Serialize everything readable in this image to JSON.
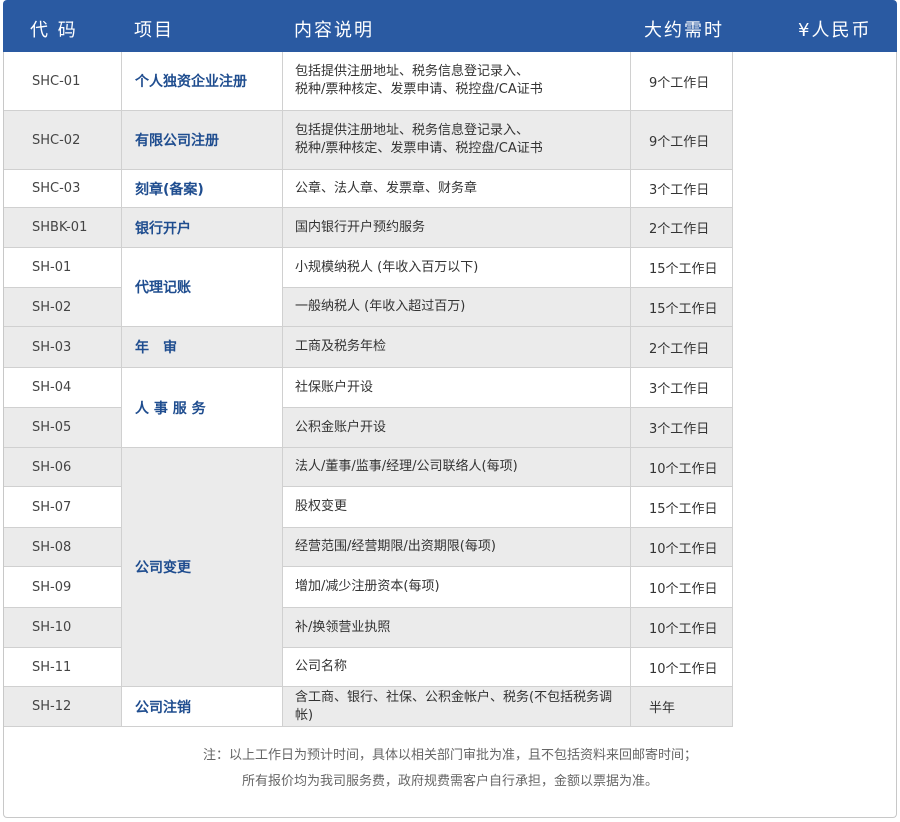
{
  "header": {
    "code": "代 码",
    "item": "项目",
    "desc": "内容说明",
    "time": "大约需时",
    "price": "¥人民币"
  },
  "rows": [
    {
      "code": "SHC-01",
      "desc": "包括提供注册地址、税务信息登记录入、\n税种/票种核定、发票申请、税控盘/CA证书",
      "time": "9个工作日"
    },
    {
      "code": "SHC-02",
      "desc": "包括提供注册地址、税务信息登记录入、\n税种/票种核定、发票申请、税控盘/CA证书",
      "time": "9个工作日"
    },
    {
      "code": "SHC-03",
      "desc": "公章、法人章、发票章、财务章",
      "time": "3个工作日"
    },
    {
      "code": "SHBK-01",
      "desc": "国内银行开户预约服务",
      "time": "2个工作日"
    },
    {
      "code": "SH-01",
      "desc": "小规模纳税人 (年收入百万以下)",
      "time": "15个工作日"
    },
    {
      "code": "SH-02",
      "desc": "一般纳税人 (年收入超过百万)",
      "time": "15个工作日"
    },
    {
      "code": "SH-03",
      "desc": "工商及税务年检",
      "time": "2个工作日"
    },
    {
      "code": "SH-04",
      "desc": "社保账户开设",
      "time": "3个工作日"
    },
    {
      "code": "SH-05",
      "desc": "公积金账户开设",
      "time": "3个工作日"
    },
    {
      "code": "SH-06",
      "desc": "法人/董事/监事/经理/公司联络人(每项)",
      "time": "10个工作日"
    },
    {
      "code": "SH-07",
      "desc": "股权变更",
      "time": "15个工作日"
    },
    {
      "code": "SH-08",
      "desc": "经营范围/经营期限/出资期限(每项)",
      "time": "10个工作日"
    },
    {
      "code": "SH-09",
      "desc": "增加/减少注册资本(每项)",
      "time": "10个工作日"
    },
    {
      "code": "SH-10",
      "desc": "补/换领营业执照",
      "time": "10个工作日"
    },
    {
      "code": "SH-11",
      "desc": "公司名称",
      "time": "10个工作日"
    },
    {
      "code": "SH-12",
      "desc": "含工商、银行、社保、公积金帐户、税务(不包括税务调帐)",
      "time": "半年"
    }
  ],
  "items": [
    {
      "label": "个人独资企业注册"
    },
    {
      "label": "有限公司注册"
    },
    {
      "label": "刻章(备案)"
    },
    {
      "label": "银行开户"
    },
    {
      "label": "代理记账"
    },
    {
      "label": "年　审"
    },
    {
      "label": "人 事 服 务"
    },
    {
      "label": "公司变更"
    },
    {
      "label": "公司注销"
    }
  ],
  "note": {
    "line1": "注：以上工作日为预计时间，具体以相关部门审批为准，且不包括资料来回邮寄时间；",
    "line2": "所有报价均为我司服务费，政府规费需客户自行承担，金额以票据为准。"
  }
}
